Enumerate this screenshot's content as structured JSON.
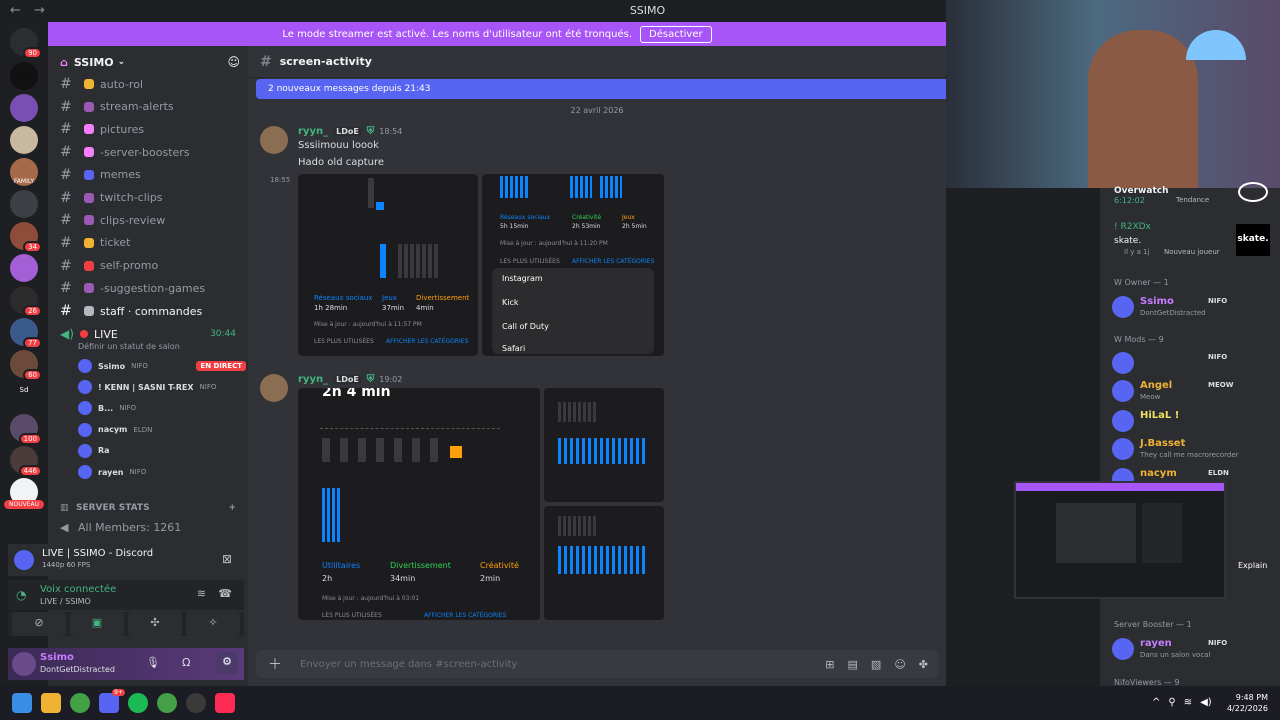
{
  "window": {
    "title": "SSIMO",
    "back": "←",
    "forward": "→"
  },
  "banner": {
    "text": "Le mode streamer est activé. Les noms d'utilisateur ont été tronqués.",
    "button": "Désactiver"
  },
  "servers": {
    "badges": [
      "90",
      "34",
      "26",
      "77",
      "60",
      "100",
      "446"
    ],
    "labels": [
      "FAMILY",
      "Sd",
      "NOUVEAU"
    ]
  },
  "sidebar": {
    "server_name": "SSIMO",
    "channels": [
      {
        "label": "auto-rol",
        "color": "#f0b232"
      },
      {
        "label": "stream-alerts",
        "color": "#9b59b6"
      },
      {
        "label": "pictures",
        "color": "#f47fff"
      },
      {
        "label": "-server-boosters",
        "color": "#f47fff"
      },
      {
        "label": "memes",
        "color": "#5865f2"
      },
      {
        "label": "twitch-clips",
        "color": "#9b59b6"
      },
      {
        "label": "clips-review",
        "color": "#9b59b6"
      },
      {
        "label": "ticket",
        "color": "#f0b232"
      },
      {
        "label": "self-promo",
        "color": "#f23f43"
      },
      {
        "label": "-suggestion-games",
        "color": "#9b59b6"
      },
      {
        "label": "staff · commandes",
        "color": "#b5bac1"
      }
    ],
    "voice_channel": {
      "name": "LIVE",
      "timer": "30:44",
      "status_hint": "Définir un statut de salon"
    },
    "voice_users": [
      {
        "name": "Ssimo",
        "tag": "NIFO",
        "badge": "EN DIRECT"
      },
      {
        "name": "! KENN | SASNI T-REX",
        "tag": "NIFO",
        "badge": ""
      },
      {
        "name": "B...",
        "tag": "NIFO",
        "badge": ""
      },
      {
        "name": "nacym",
        "tag": "ELDN",
        "badge": ""
      },
      {
        "name": "Ra",
        "tag": "",
        "badge": ""
      },
      {
        "name": "rayen",
        "tag": "NIFO",
        "badge": ""
      }
    ],
    "stats_category": "SERVER STATS",
    "stats_member": "All Members: 1261",
    "stream_panel": {
      "title": "LIVE | SSIMO - Discord",
      "quality": "1440p 60 FPS"
    },
    "voice_panel": {
      "status": "Voix connectée",
      "channel": "LIVE / SSIMO"
    },
    "user_panel": {
      "name": "Ssimo",
      "status": "DontGetDistracted"
    }
  },
  "chat": {
    "channel": "screen-activity",
    "new_messages": "2 nouveaux messages depuis 21:43",
    "date": "22 avril 2026",
    "messages": [
      {
        "author": "ryyn_",
        "tag": "LDoE",
        "time": "18:54",
        "lines": [
          "Sssiimouu loook",
          "Hado old capture"
        ],
        "side_time": "18:55"
      },
      {
        "author": "ryyn_",
        "tag": "LDoE",
        "time": "19:02",
        "lines": [],
        "side_time": ""
      }
    ],
    "screens": {
      "left1": {
        "a": "Réseaux sociaux",
        "b": "Jeux",
        "c": "Divertissement",
        "av": "1h 28min",
        "bv": "37min",
        "cv": "4min",
        "update": "Mise à jour : aujourd'hui à 11:57 PM",
        "more": "LES PLUS UTILISÉES",
        "all": "AFFICHER LES CATÉGORIES"
      },
      "right1": {
        "a": "Réseaux sociaux",
        "b": "Créativité",
        "c": "Jeux",
        "av": "5h 15min",
        "bv": "2h 53min",
        "cv": "2h 5min",
        "update": "Mise à jour : aujourd'hui à 11:20 PM",
        "more": "LES PLUS UTILISÉES",
        "all": "AFFICHER LES CATÉGORIES",
        "apps": [
          "Instagram",
          "Kick",
          "Call of Duty",
          "Safari"
        ]
      },
      "left2": {
        "headline": "2h 4 min",
        "a": "Utilitaires",
        "b": "Divertissement",
        "c": "Créativité",
        "av": "2h",
        "bv": "34min",
        "cv": "2min",
        "update": "Mise à jour : aujourd'hui à 03:01",
        "more": "LES PLUS UTILISÉES",
        "all": "AFFICHER LES CATÉGORIES"
      }
    },
    "composer_placeholder": "Envoyer un message dans #screen-activity"
  },
  "members": {
    "top_game": {
      "name": "Overwatch",
      "time": "6:12:02",
      "trend": "Tendance"
    },
    "top_user": {
      "name": "! R2XDx",
      "game": "skate.",
      "note": "Il y a 1j",
      "status": "Nouveau joueur",
      "logo": "skate."
    },
    "sections": [
      {
        "title": "W Owner — 1"
      },
      {
        "title": "W Mods — 9"
      },
      {
        "title": "Server Booster — 1"
      },
      {
        "title": "NifoViewers — 9"
      }
    ],
    "list": [
      {
        "name": "Ssimo",
        "tag": "NIFO",
        "status": "DontGetDistracted",
        "color": "#c77dff"
      },
      {
        "name": "",
        "tag": "NIFO",
        "status": "",
        "color": "#f23f43"
      },
      {
        "name": "Angel",
        "tag": "MEOW",
        "status": "Meow",
        "color": "#f0b232"
      },
      {
        "name": "HiLaL !",
        "tag": "",
        "status": "",
        "color": "#f0e060"
      },
      {
        "name": "J.Basset",
        "tag": "",
        "status": "They call me macrorecorder",
        "color": "#f0b232"
      },
      {
        "name": "nacym",
        "tag": "ELDN",
        "status": "",
        "color": "#f0b232"
      },
      {
        "name": "rayen",
        "tag": "NIFO",
        "status": "Dans un salon vocal",
        "color": "#c77dff"
      }
    ],
    "explain": "Explain"
  },
  "taskbar": {
    "time": "9:48 PM",
    "date": "4/22/2026",
    "badge": "9+"
  }
}
